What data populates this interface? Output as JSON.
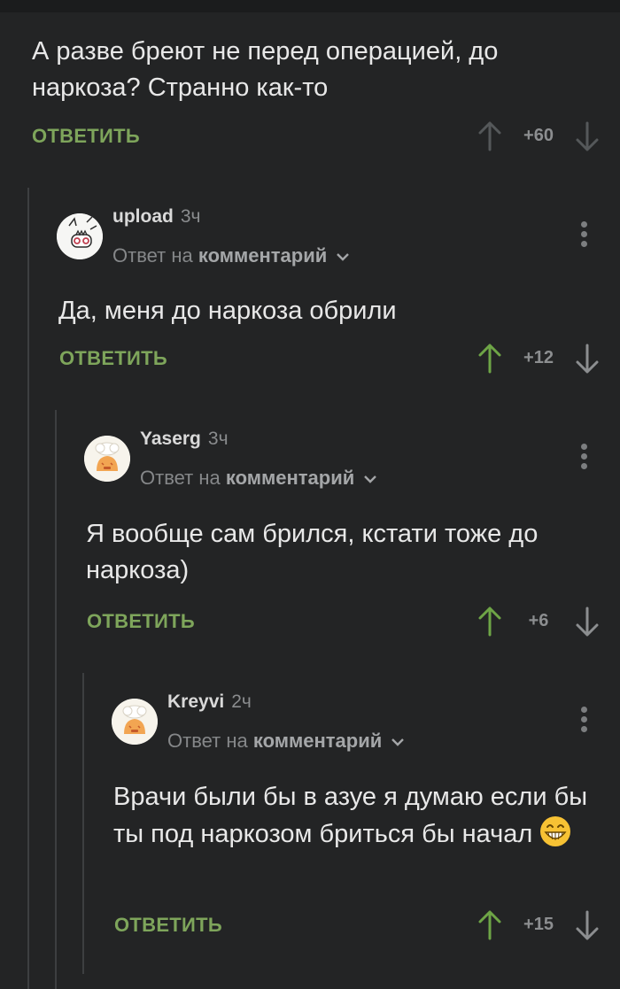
{
  "comments": [
    {
      "text": "А разве бреют не перед операцией, до наркоза? Странно как-то",
      "reply_label": "ОТВЕТИТЬ",
      "score": "+60",
      "upvoted": false
    },
    {
      "username": "upload",
      "time": "3ч",
      "reply_to_prefix": "Ответ на",
      "reply_to_link": "комментарий",
      "text": "Да, меня до наркоза обрили",
      "reply_label": "ОТВЕТИТЬ",
      "score": "+12",
      "upvoted": true
    },
    {
      "username": "Yaserg",
      "time": "3ч",
      "reply_to_prefix": "Ответ на",
      "reply_to_link": "комментарий",
      "text": "Я вообще сам брился, кстати тоже до наркоза)",
      "reply_label": "ОТВЕТИТЬ",
      "score": "+6",
      "upvoted": true
    },
    {
      "username": "Kreyvi",
      "time": "2ч",
      "reply_to_prefix": "Ответ на",
      "reply_to_link": "комментарий",
      "text": "Врачи были бы в азуе я думаю если бы ты под наркозом бриться бы начал",
      "emoji": "grinning-face-emoji",
      "reply_label": "ОТВЕТИТЬ",
      "score": "+15",
      "upvoted": true
    }
  ],
  "colors": {
    "background": "#232425",
    "reply_green": "#7ea55b",
    "upvote_green": "#6ea546",
    "muted": "#8c8e90",
    "thread_line": "#3d3f41"
  },
  "icons": {
    "upvote": "arrow-up-icon",
    "downvote": "arrow-down-icon",
    "more": "more-vertical-icon",
    "expand": "chevron-down-icon"
  }
}
